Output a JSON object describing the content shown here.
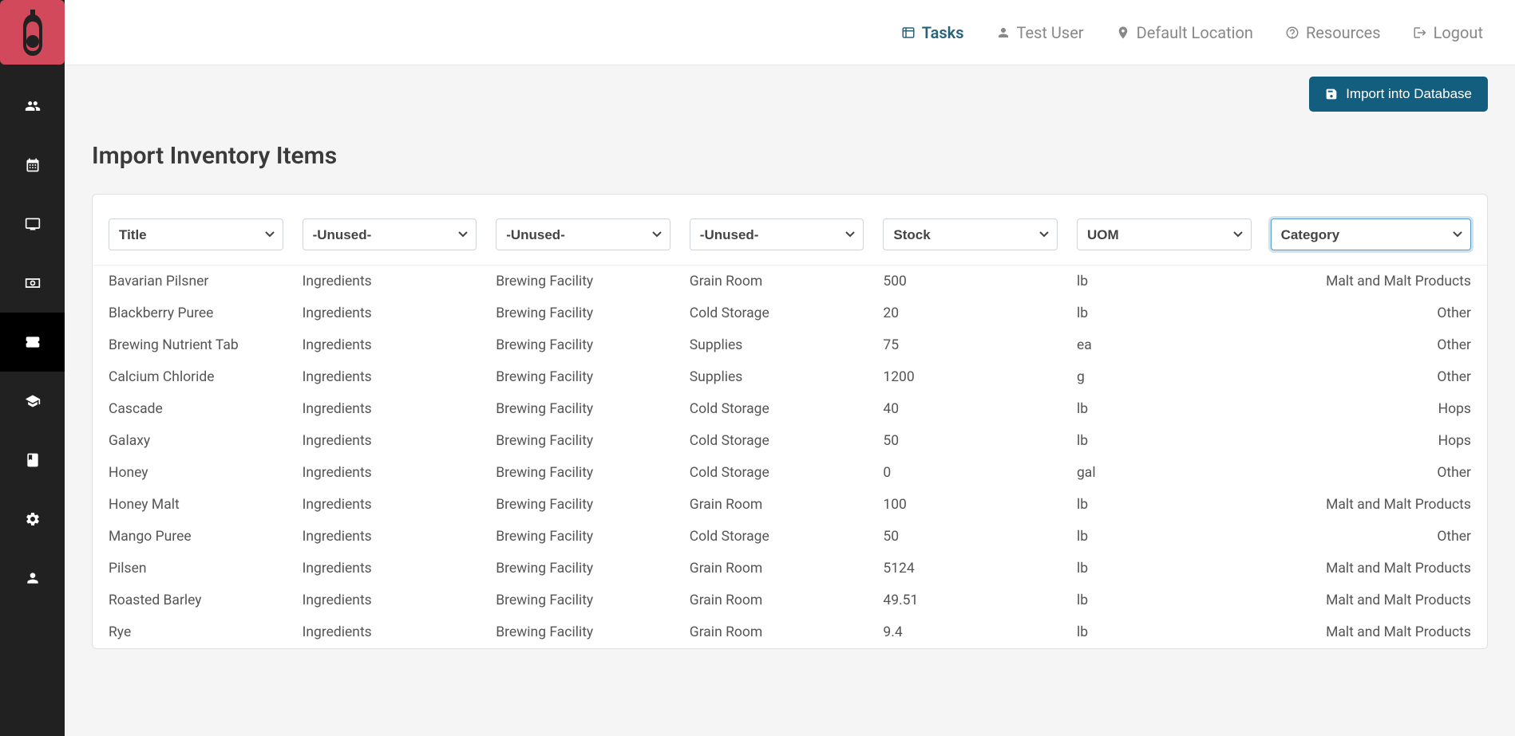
{
  "topnav": {
    "tasks": "Tasks",
    "user": "Test User",
    "location": "Default Location",
    "resources": "Resources",
    "logout": "Logout"
  },
  "sidebar": {
    "items": [
      {
        "name": "customers",
        "icon": "users"
      },
      {
        "name": "calendar",
        "icon": "calendar"
      },
      {
        "name": "display",
        "icon": "monitor"
      },
      {
        "name": "billing",
        "icon": "cash"
      },
      {
        "name": "inventory",
        "icon": "ticket",
        "active": true
      },
      {
        "name": "education",
        "icon": "grad-cap"
      },
      {
        "name": "docs",
        "icon": "book"
      },
      {
        "name": "settings",
        "icon": "gear"
      },
      {
        "name": "account",
        "icon": "person"
      }
    ]
  },
  "page": {
    "title": "Import Inventory Items",
    "import_button": "Import into Database"
  },
  "columns": [
    {
      "value": "Title",
      "focused": false
    },
    {
      "value": "-Unused-",
      "focused": false
    },
    {
      "value": "-Unused-",
      "focused": false
    },
    {
      "value": "-Unused-",
      "focused": false
    },
    {
      "value": "Stock",
      "focused": false
    },
    {
      "value": "UOM",
      "focused": false
    },
    {
      "value": "Category",
      "focused": true
    }
  ],
  "rows": [
    {
      "c0": "Bavarian Pilsner",
      "c1": "Ingredients",
      "c2": "Brewing Facility",
      "c3": "Grain Room",
      "c4": "500",
      "c5": "lb",
      "c6": "Malt and Malt Products"
    },
    {
      "c0": "Blackberry Puree",
      "c1": "Ingredients",
      "c2": "Brewing Facility",
      "c3": "Cold Storage",
      "c4": "20",
      "c5": "lb",
      "c6": "Other"
    },
    {
      "c0": "Brewing Nutrient Tab",
      "c1": "Ingredients",
      "c2": "Brewing Facility",
      "c3": "Supplies",
      "c4": "75",
      "c5": "ea",
      "c6": "Other"
    },
    {
      "c0": "Calcium Chloride",
      "c1": "Ingredients",
      "c2": "Brewing Facility",
      "c3": "Supplies",
      "c4": "1200",
      "c5": "g",
      "c6": "Other"
    },
    {
      "c0": "Cascade",
      "c1": "Ingredients",
      "c2": "Brewing Facility",
      "c3": "Cold Storage",
      "c4": "40",
      "c5": "lb",
      "c6": "Hops"
    },
    {
      "c0": "Galaxy",
      "c1": "Ingredients",
      "c2": "Brewing Facility",
      "c3": "Cold Storage",
      "c4": "50",
      "c5": "lb",
      "c6": "Hops"
    },
    {
      "c0": "Honey",
      "c1": "Ingredients",
      "c2": "Brewing Facility",
      "c3": "Cold Storage",
      "c4": "0",
      "c5": "gal",
      "c6": "Other"
    },
    {
      "c0": "Honey Malt",
      "c1": "Ingredients",
      "c2": "Brewing Facility",
      "c3": "Grain Room",
      "c4": "100",
      "c5": "lb",
      "c6": "Malt and Malt Products"
    },
    {
      "c0": "Mango Puree",
      "c1": "Ingredients",
      "c2": "Brewing Facility",
      "c3": "Cold Storage",
      "c4": "50",
      "c5": "lb",
      "c6": "Other"
    },
    {
      "c0": "Pilsen",
      "c1": "Ingredients",
      "c2": "Brewing Facility",
      "c3": "Grain Room",
      "c4": "5124",
      "c5": "lb",
      "c6": "Malt and Malt Products"
    },
    {
      "c0": "Roasted Barley",
      "c1": "Ingredients",
      "c2": "Brewing Facility",
      "c3": "Grain Room",
      "c4": "49.51",
      "c5": "lb",
      "c6": "Malt and Malt Products"
    },
    {
      "c0": "Rye",
      "c1": "Ingredients",
      "c2": "Brewing Facility",
      "c3": "Grain Room",
      "c4": "9.4",
      "c5": "lb",
      "c6": "Malt and Malt Products"
    }
  ]
}
